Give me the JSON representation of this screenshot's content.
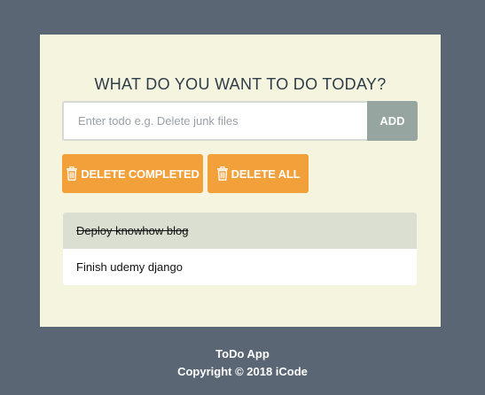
{
  "app": {
    "heading": "WHAT DO YOU WANT TO DO TODAY?"
  },
  "form": {
    "input_placeholder": "Enter todo e.g. Delete junk files",
    "input_value": "",
    "add_label": "ADD"
  },
  "actions": {
    "delete_completed_label": "DELETE COMPLETED",
    "delete_all_label": "DELETE ALL",
    "button_color": "#f2a03a",
    "icon": "trash-icon"
  },
  "todos": [
    {
      "text": "Deploy knowhow blog",
      "completed": true
    },
    {
      "text": "Finish udemy django",
      "completed": false
    }
  ],
  "footer": {
    "app_name": "ToDo App",
    "copyright": "Copyright © 2018 iCode"
  }
}
